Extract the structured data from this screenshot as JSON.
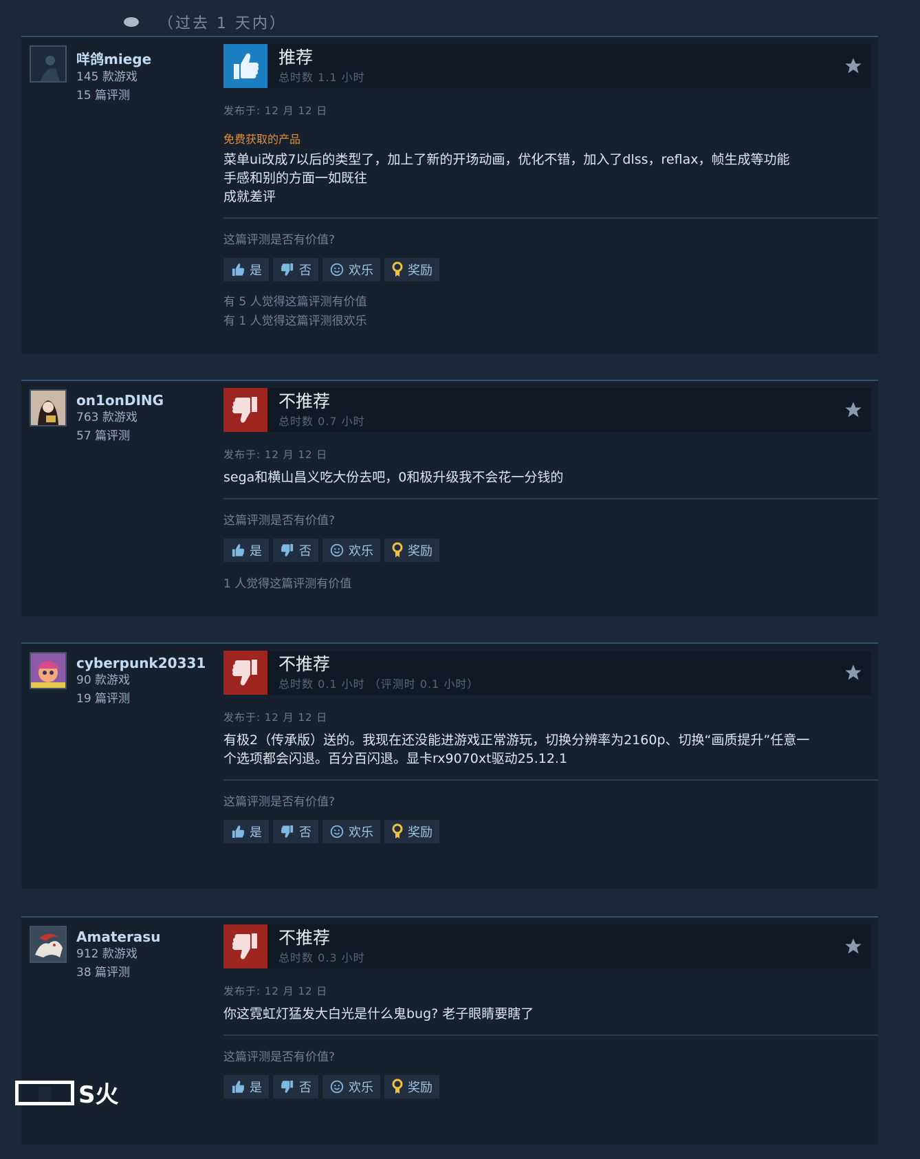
{
  "header": {
    "time_filter": "（过去 1 天内）"
  },
  "ui": {
    "helpful_question": "这篇评测是否有价值?",
    "vote_yes": "是",
    "vote_no": "否",
    "vote_funny": "欢乐",
    "vote_award": "奖励"
  },
  "reviews": [
    {
      "author": "咩鸽miege",
      "games": "145 款游戏",
      "reviews": "15 篇评测",
      "verdict": "推荐",
      "verdict_type": "up",
      "hours": "总时数 1.1 小时",
      "posted": "发布于: 12 月 12 日",
      "tag": "免费获取的产品",
      "body": "菜单ui改成7以后的类型了，加上了新的开场动画，优化不错，加入了dlss，reflax，帧生成等功能\n手感和别的方面一如既往\n成就差评",
      "found_helpful": "有 5 人觉得这篇评测有价值",
      "found_funny": "有 1 人觉得这篇评测很欢乐"
    },
    {
      "author": "on1onDING",
      "games": "763 款游戏",
      "reviews": "57 篇评测",
      "verdict": "不推荐",
      "verdict_type": "down",
      "hours": "总时数 0.7 小时",
      "posted": "发布于: 12 月 12 日",
      "body": "sega和横山昌义吃大份去吧，0和极升级我不会花一分钱的",
      "found_helpful": "1 人觉得这篇评测有价值"
    },
    {
      "author": "cyberpunk20331",
      "games": "90 款游戏",
      "reviews": "19 篇评测",
      "verdict": "不推荐",
      "verdict_type": "down",
      "hours": "总时数 0.1 小时 （评测时 0.1 小时）",
      "posted": "发布于: 12 月 12 日",
      "body": "有极2（传承版）送的。我现在还没能进游戏正常游玩，切换分辨率为2160p、切换“画质提升”任意一\n个选项都会闪退。百分百闪退。显卡rx9070xt驱动25.12.1"
    },
    {
      "author": "Amaterasu",
      "games": "912 款游戏",
      "reviews": "38 篇评测",
      "verdict": "不推荐",
      "verdict_type": "down",
      "hours": "总时数 0.3 小时",
      "posted": "发布于: 12 月 12 日",
      "body": "你这霓虹灯猛发大白光是什么鬼bug? 老子眼睛要瞎了"
    }
  ],
  "watermark": {
    "text": "S火"
  },
  "colors": {
    "background": "#1b2838",
    "card": "#17212e",
    "thumb_up": "#1c7fc2",
    "thumb_down": "#9e2520",
    "free_tag": "#e28e3a"
  }
}
